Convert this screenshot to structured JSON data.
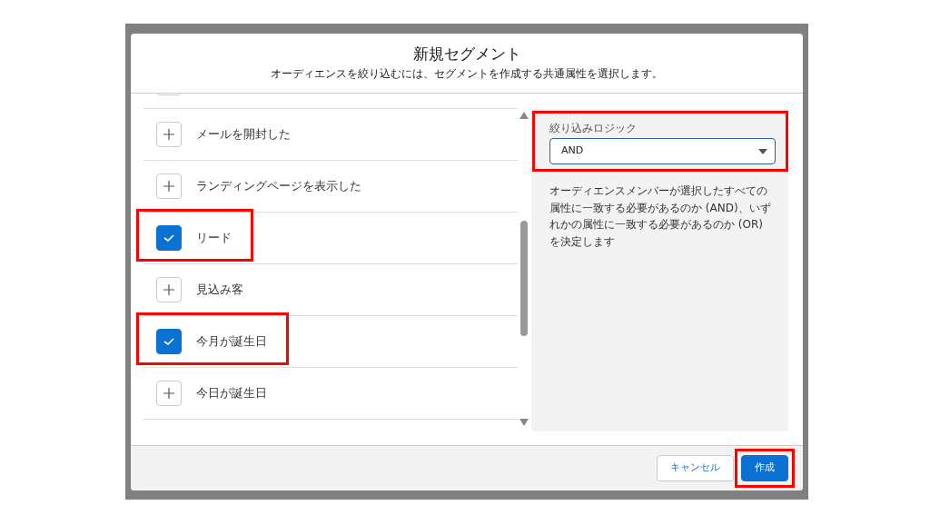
{
  "modal": {
    "title": "新規セグメント",
    "subtitle": "オーディエンスを絞り込むには、セグメントを作成する共通属性を選択します。"
  },
  "attributes": [
    {
      "checked": false,
      "highlighted": false
    },
    {
      "label": "メールを開封した",
      "checked": false,
      "highlighted": false
    },
    {
      "label": "ランディングページを表示した",
      "checked": false,
      "highlighted": false
    },
    {
      "label": "リード",
      "checked": true,
      "highlighted": true
    },
    {
      "label": "見込み客",
      "checked": false,
      "highlighted": false
    },
    {
      "label": "今月が誕生日",
      "checked": true,
      "highlighted": true
    },
    {
      "label": "今日が誕生日",
      "checked": false,
      "highlighted": false
    }
  ],
  "filter_logic": {
    "label": "絞り込みロジック",
    "value": "AND",
    "highlighted": true,
    "help": "オーディエンスメンバーが選択したすべての属性に一致する必要があるのか (AND)、いずれかの属性に一致する必要があるのか (OR) を決定します"
  },
  "buttons": [
    {
      "label": "キャンセル",
      "kind": "neutral",
      "highlighted": false
    },
    {
      "label": "作成",
      "kind": "brand",
      "highlighted": true
    }
  ]
}
